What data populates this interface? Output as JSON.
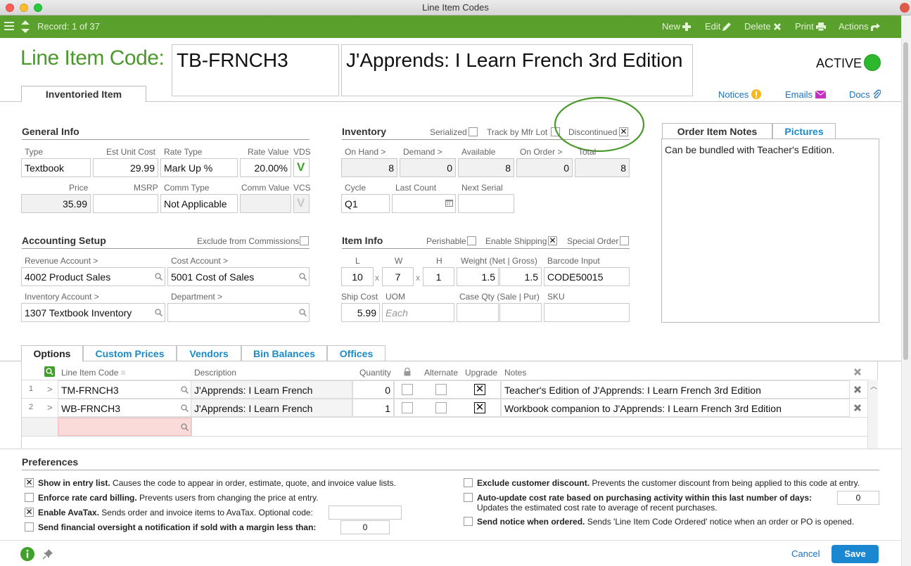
{
  "window": {
    "title": "Line Item Codes"
  },
  "toolbar": {
    "record": "Record: 1 of 37",
    "new": "New",
    "edit": "Edit",
    "delete": "Delete",
    "print": "Print",
    "actions": "Actions"
  },
  "header": {
    "label": "Line Item Code:",
    "code": "TB-FRNCH3",
    "description": "J'Apprends: I Learn French 3rd Edition",
    "status": "ACTIVE",
    "status_color": "#2db82d",
    "tab": "Inventoried Item",
    "notices": "Notices",
    "emails": "Emails",
    "docs": "Docs"
  },
  "general": {
    "title": "General Info",
    "type_label": "Type",
    "type": "Textbook",
    "est_label": "Est Unit Cost",
    "est": "29.99",
    "rate_type_label": "Rate Type",
    "rate_type": "Mark Up %",
    "rate_value_label": "Rate Value",
    "rate_value": "20.00%",
    "vds_label": "VDS",
    "vds": "V",
    "price_label": "Price",
    "price": "35.99",
    "msrp_label": "MSRP",
    "msrp": "",
    "comm_type_label": "Comm Type",
    "comm_type": "Not Applicable",
    "comm_value_label": "Comm Value",
    "comm_value": "",
    "vcs_label": "VCS",
    "vcs": "V"
  },
  "inventory": {
    "title": "Inventory",
    "serialized": "Serialized",
    "track": "Track by Mfr Lot",
    "discontinued": "Discontinued",
    "discontinued_checked": "✕",
    "on_hand_label": "On Hand >",
    "on_hand": "8",
    "demand_label": "Demand >",
    "demand": "0",
    "available_label": "Available",
    "available": "8",
    "on_order_label": "On Order >",
    "on_order": "0",
    "total_label": "Total",
    "total": "8",
    "cycle_label": "Cycle",
    "cycle": "Q1",
    "last_count_label": "Last Count",
    "last_count": "",
    "next_serial_label": "Next Serial",
    "next_serial": ""
  },
  "notes": {
    "tab1": "Order Item Notes",
    "tab2": "Pictures",
    "text": "Can be bundled with Teacher's Edition."
  },
  "accounting": {
    "title": "Accounting Setup",
    "exclude": "Exclude from Commissions",
    "revenue_label": "Revenue Account >",
    "revenue": "4002 Product Sales",
    "cost_label": "Cost Account >",
    "cost": "5001 Cost of Sales",
    "inventory_label": "Inventory Account >",
    "inventory": "1307 Textbook Inventory",
    "department_label": "Department >",
    "department": ""
  },
  "iteminfo": {
    "title": "Item Info",
    "perishable": "Perishable",
    "shipping": "Enable Shipping",
    "shipping_checked": "✕",
    "special": "Special Order",
    "l_label": "L",
    "l": "10",
    "w_label": "W",
    "w": "7",
    "h_label": "H",
    "h": "1",
    "x": "x",
    "weight_label": "Weight (Net | Gross)",
    "net": "1.5",
    "gross": "1.5",
    "barcode_label": "Barcode Input",
    "barcode": "CODE50015",
    "ship_label": "Ship Cost",
    "ship": "5.99",
    "uom_label": "UOM",
    "uom_placeholder": "Each",
    "case_label": "Case Qty (Sale | Pur)",
    "sku_label": "SKU"
  },
  "tabs": [
    "Options",
    "Custom Prices",
    "Vendors",
    "Bin Balances",
    "Offices"
  ],
  "options": {
    "headers": {
      "code": "Line Item Code",
      "description": "Description",
      "quantity": "Quantity",
      "alternate": "Alternate",
      "upgrade": "Upgrade",
      "notes": "Notes"
    },
    "rows": [
      {
        "num": "1",
        "arrow": ">",
        "code": "TM-FRNCH3",
        "description": "J'Apprends: I Learn French",
        "quantity": "0",
        "upgrade": "✕",
        "notes": "Teacher's Edition of J'Apprends: I Learn French 3rd Edition"
      },
      {
        "num": "2",
        "arrow": ">",
        "code": "WB-FRNCH3",
        "description": "J'Apprends: I Learn French",
        "quantity": "1",
        "upgrade": "✕",
        "notes": "Workbook companion to J'Apprends: I Learn French 3rd Edition"
      }
    ]
  },
  "preferences": {
    "title": "Preferences",
    "p1_b": "Show in entry list.",
    "p1": " Causes the code to appear in order, estimate, quote, and invoice value lists.",
    "p1_c": "✕",
    "p2_b": "Enforce rate card billing.",
    "p2": " Prevents users from changing the price at entry.",
    "p3_b": "Enable AvaTax.",
    "p3": " Sends order and invoice items to AvaTax. Optional code:",
    "p3_c": "✕",
    "p4_b": "Send financial oversight a notification if sold with a margin less than:",
    "p4_v": "0",
    "p5_b": "Exclude customer discount.",
    "p5": " Prevents the customer discount from being applied to this code at entry.",
    "p6_b": "Auto-update cost rate based on purchasing activity within this last number of days:",
    "p6_v": "0",
    "p6_sub": "Updates the estimated cost rate to average of recent purchases.",
    "p7_b": "Send notice when ordered.",
    "p7": " Sends 'Line Item Code Ordered' notice when an order or PO is opened."
  },
  "footer": {
    "cancel": "Cancel",
    "save": "Save"
  }
}
